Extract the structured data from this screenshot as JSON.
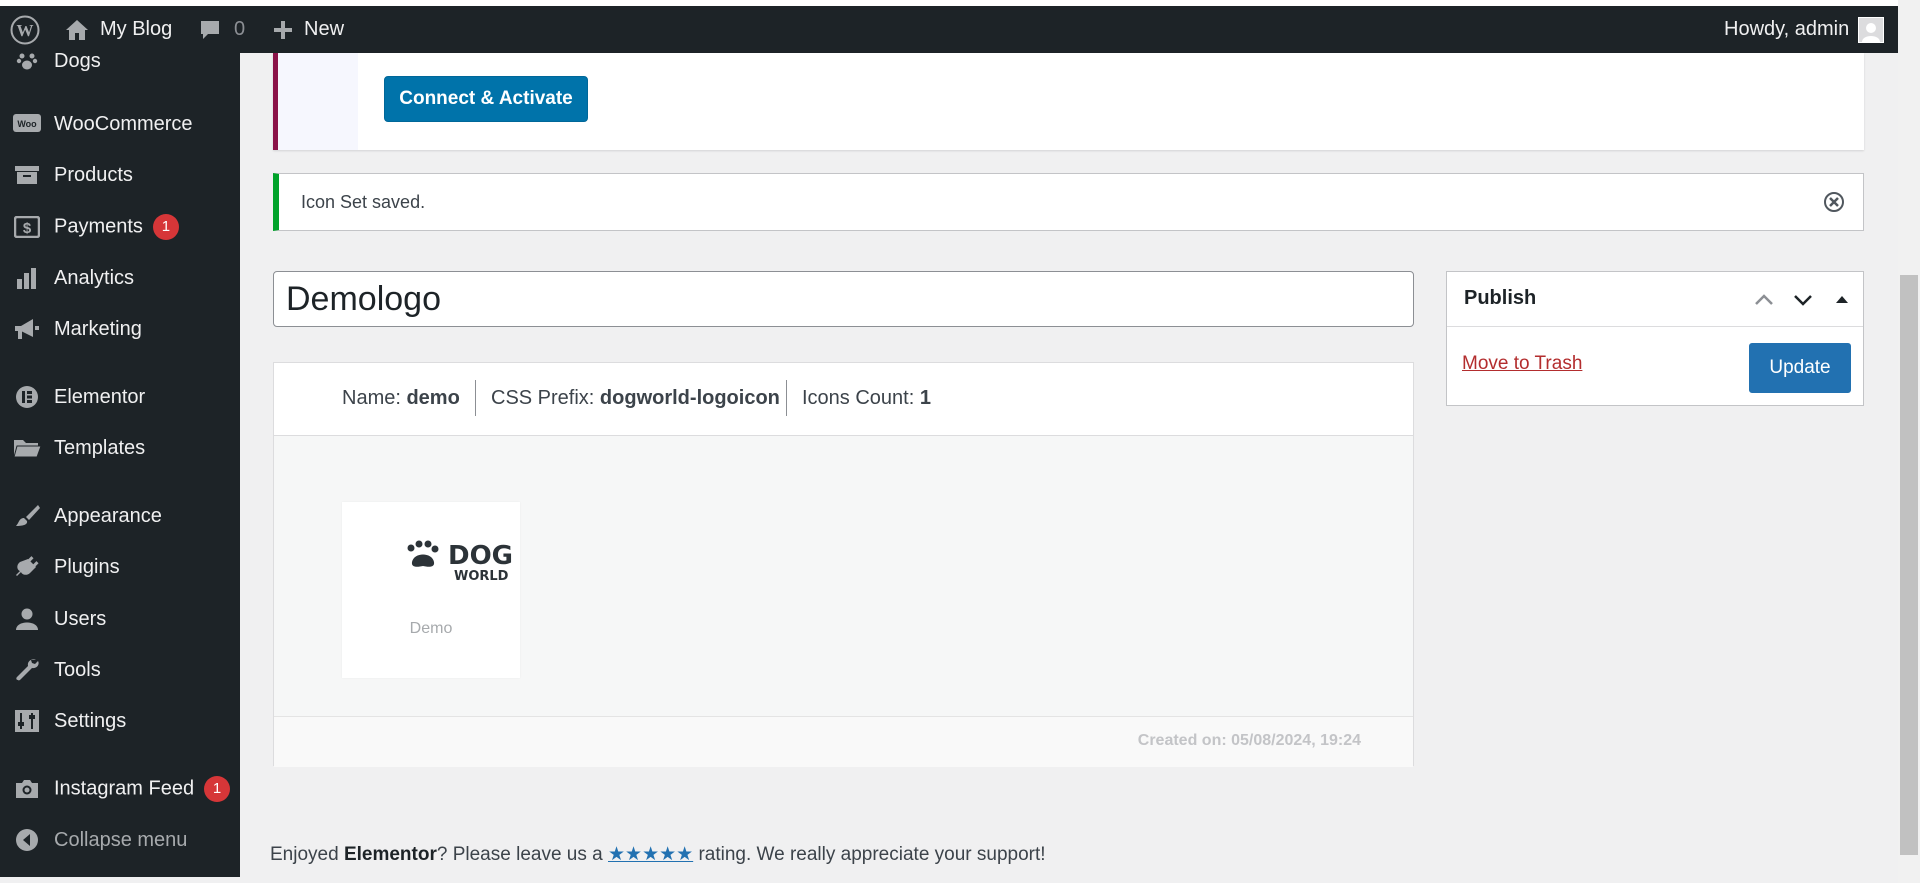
{
  "adminbar": {
    "site_name": "My Blog",
    "comments_count": "0",
    "new_label": "New",
    "greeting": "Howdy, admin"
  },
  "sidebar": {
    "items": [
      {
        "label": "Dogs",
        "icon": "paw-icon"
      },
      {
        "label": "WooCommerce",
        "icon": "woo-icon"
      },
      {
        "label": "Products",
        "icon": "archive-icon"
      },
      {
        "label": "Payments",
        "icon": "dollar-icon",
        "badge": "1"
      },
      {
        "label": "Analytics",
        "icon": "bar-chart-icon"
      },
      {
        "label": "Marketing",
        "icon": "megaphone-icon"
      },
      {
        "label": "Elementor",
        "icon": "elementor-icon"
      },
      {
        "label": "Templates",
        "icon": "folder-icon"
      },
      {
        "label": "Appearance",
        "icon": "brush-icon"
      },
      {
        "label": "Plugins",
        "icon": "plug-icon"
      },
      {
        "label": "Users",
        "icon": "user-icon"
      },
      {
        "label": "Tools",
        "icon": "wrench-icon"
      },
      {
        "label": "Settings",
        "icon": "sliders-icon"
      },
      {
        "label": "Instagram Feed",
        "icon": "camera-icon",
        "badge": "1"
      }
    ],
    "collapse_label": "Collapse menu"
  },
  "notice": {
    "connect_button": "Connect & Activate",
    "saved_message": "Icon Set saved."
  },
  "editor": {
    "title_value": "Demologo",
    "name_label": "Name:",
    "name_value": "demo",
    "prefix_label": "CSS Prefix:",
    "prefix_value": "dogworld-logoicon",
    "count_label": "Icons Count:",
    "count_value": "1",
    "icon_caption": "Demo",
    "created_text": "Created on: 05/08/2024, 19:24"
  },
  "publish": {
    "title": "Publish",
    "trash_label": "Move to Trash",
    "update_label": "Update"
  },
  "footer": {
    "pre": "Enjoyed ",
    "brand": "Elementor",
    "mid": "? Please leave us a ",
    "stars": "★★★★★",
    "post": " rating. We really appreciate your support!"
  },
  "colors": {
    "adminbar": "#1d2327",
    "primary_button": "#2271b1",
    "success_border": "#00a32a",
    "badge": "#d63638",
    "elementor_accent": "#8a1248"
  }
}
